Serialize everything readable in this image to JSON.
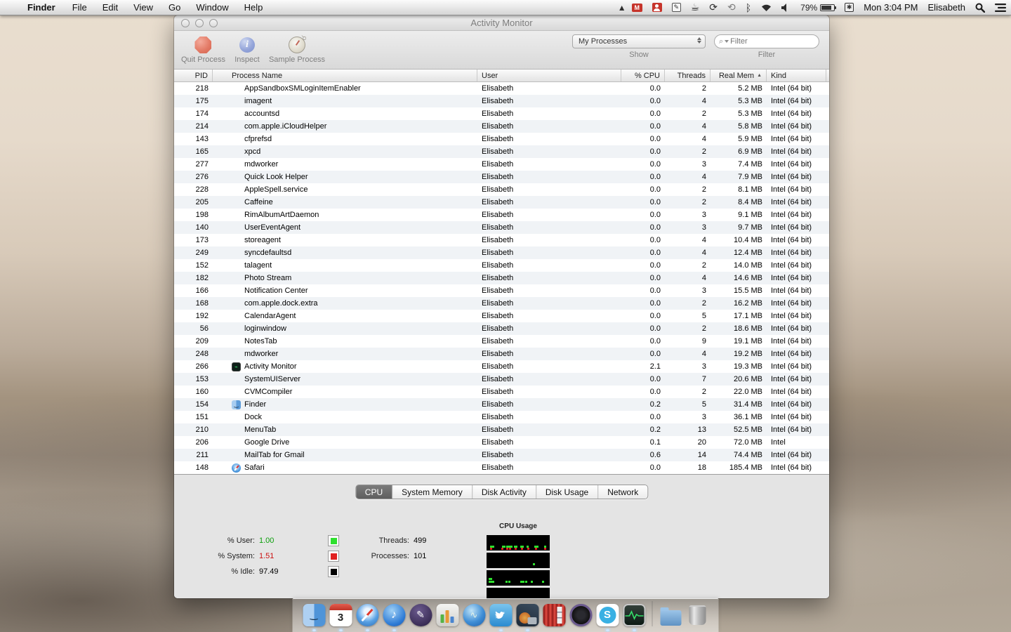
{
  "menu_bar": {
    "apple_logo": "",
    "app_name": "Finder",
    "items": [
      "File",
      "Edit",
      "View",
      "Go",
      "Window",
      "Help"
    ],
    "status": {
      "battery_percent": "79%",
      "clock": "Mon 3:04 PM",
      "user_name": "Elisabeth",
      "icons": [
        "google-drive-icon",
        "gmail-icon",
        "contacts-icon",
        "notes-icon",
        "caffeine-icon",
        "sync-icon",
        "time-machine-icon",
        "bluetooth-icon",
        "wifi-icon",
        "volume-icon",
        "battery-icon",
        "input-menu-icon",
        "spotlight-icon",
        "notification-center-icon"
      ]
    }
  },
  "window": {
    "title": "Activity Monitor",
    "toolbar": {
      "quit_label": "Quit Process",
      "inspect_label": "Inspect",
      "sample_label": "Sample Process",
      "show_value": "My Processes",
      "show_label": "Show",
      "filter_placeholder": "Filter",
      "filter_label": "Filter"
    },
    "table": {
      "columns": [
        "PID",
        "Process Name",
        "User",
        "% CPU",
        "Threads",
        "Real Mem",
        "Kind"
      ],
      "sort_column": "Real Mem",
      "sort_arrow": "▲",
      "rows": [
        {
          "pid": "218",
          "name": "AppSandboxSMLoginItemEnabler",
          "icon": "",
          "user": "Elisabeth",
          "cpu": "0.0",
          "threads": "2",
          "mem": "5.2 MB",
          "kind": "Intel (64 bit)"
        },
        {
          "pid": "175",
          "name": "imagent",
          "icon": "",
          "user": "Elisabeth",
          "cpu": "0.0",
          "threads": "4",
          "mem": "5.3 MB",
          "kind": "Intel (64 bit)"
        },
        {
          "pid": "174",
          "name": "accountsd",
          "icon": "",
          "user": "Elisabeth",
          "cpu": "0.0",
          "threads": "2",
          "mem": "5.3 MB",
          "kind": "Intel (64 bit)"
        },
        {
          "pid": "214",
          "name": "com.apple.iCloudHelper",
          "icon": "",
          "user": "Elisabeth",
          "cpu": "0.0",
          "threads": "4",
          "mem": "5.8 MB",
          "kind": "Intel (64 bit)"
        },
        {
          "pid": "143",
          "name": "cfprefsd",
          "icon": "",
          "user": "Elisabeth",
          "cpu": "0.0",
          "threads": "4",
          "mem": "5.9 MB",
          "kind": "Intel (64 bit)"
        },
        {
          "pid": "165",
          "name": "xpcd",
          "icon": "",
          "user": "Elisabeth",
          "cpu": "0.0",
          "threads": "2",
          "mem": "6.9 MB",
          "kind": "Intel (64 bit)"
        },
        {
          "pid": "277",
          "name": "mdworker",
          "icon": "",
          "user": "Elisabeth",
          "cpu": "0.0",
          "threads": "3",
          "mem": "7.4 MB",
          "kind": "Intel (64 bit)"
        },
        {
          "pid": "276",
          "name": "Quick Look Helper",
          "icon": "",
          "user": "Elisabeth",
          "cpu": "0.0",
          "threads": "4",
          "mem": "7.9 MB",
          "kind": "Intel (64 bit)"
        },
        {
          "pid": "228",
          "name": "AppleSpell.service",
          "icon": "",
          "user": "Elisabeth",
          "cpu": "0.0",
          "threads": "2",
          "mem": "8.1 MB",
          "kind": "Intel (64 bit)"
        },
        {
          "pid": "205",
          "name": "Caffeine",
          "icon": "",
          "user": "Elisabeth",
          "cpu": "0.0",
          "threads": "2",
          "mem": "8.4 MB",
          "kind": "Intel (64 bit)"
        },
        {
          "pid": "198",
          "name": "RimAlbumArtDaemon",
          "icon": "",
          "user": "Elisabeth",
          "cpu": "0.0",
          "threads": "3",
          "mem": "9.1 MB",
          "kind": "Intel (64 bit)"
        },
        {
          "pid": "140",
          "name": "UserEventAgent",
          "icon": "",
          "user": "Elisabeth",
          "cpu": "0.0",
          "threads": "3",
          "mem": "9.7 MB",
          "kind": "Intel (64 bit)"
        },
        {
          "pid": "173",
          "name": "storeagent",
          "icon": "",
          "user": "Elisabeth",
          "cpu": "0.0",
          "threads": "4",
          "mem": "10.4 MB",
          "kind": "Intel (64 bit)"
        },
        {
          "pid": "249",
          "name": "syncdefaultsd",
          "icon": "",
          "user": "Elisabeth",
          "cpu": "0.0",
          "threads": "4",
          "mem": "12.4 MB",
          "kind": "Intel (64 bit)"
        },
        {
          "pid": "152",
          "name": "talagent",
          "icon": "",
          "user": "Elisabeth",
          "cpu": "0.0",
          "threads": "2",
          "mem": "14.0 MB",
          "kind": "Intel (64 bit)"
        },
        {
          "pid": "182",
          "name": "Photo Stream",
          "icon": "",
          "user": "Elisabeth",
          "cpu": "0.0",
          "threads": "4",
          "mem": "14.6 MB",
          "kind": "Intel (64 bit)"
        },
        {
          "pid": "166",
          "name": "Notification Center",
          "icon": "",
          "user": "Elisabeth",
          "cpu": "0.0",
          "threads": "3",
          "mem": "15.5 MB",
          "kind": "Intel (64 bit)"
        },
        {
          "pid": "168",
          "name": "com.apple.dock.extra",
          "icon": "",
          "user": "Elisabeth",
          "cpu": "0.0",
          "threads": "2",
          "mem": "16.2 MB",
          "kind": "Intel (64 bit)"
        },
        {
          "pid": "192",
          "name": "CalendarAgent",
          "icon": "",
          "user": "Elisabeth",
          "cpu": "0.0",
          "threads": "5",
          "mem": "17.1 MB",
          "kind": "Intel (64 bit)"
        },
        {
          "pid": "56",
          "name": "loginwindow",
          "icon": "",
          "user": "Elisabeth",
          "cpu": "0.0",
          "threads": "2",
          "mem": "18.6 MB",
          "kind": "Intel (64 bit)"
        },
        {
          "pid": "209",
          "name": "NotesTab",
          "icon": "",
          "user": "Elisabeth",
          "cpu": "0.0",
          "threads": "9",
          "mem": "19.1 MB",
          "kind": "Intel (64 bit)"
        },
        {
          "pid": "248",
          "name": "mdworker",
          "icon": "",
          "user": "Elisabeth",
          "cpu": "0.0",
          "threads": "4",
          "mem": "19.2 MB",
          "kind": "Intel (64 bit)"
        },
        {
          "pid": "266",
          "name": "Activity Monitor",
          "icon": "activity-monitor",
          "user": "Elisabeth",
          "cpu": "2.1",
          "threads": "3",
          "mem": "19.3 MB",
          "kind": "Intel (64 bit)"
        },
        {
          "pid": "153",
          "name": "SystemUIServer",
          "icon": "",
          "user": "Elisabeth",
          "cpu": "0.0",
          "threads": "7",
          "mem": "20.6 MB",
          "kind": "Intel (64 bit)"
        },
        {
          "pid": "160",
          "name": "CVMCompiler",
          "icon": "",
          "user": "Elisabeth",
          "cpu": "0.0",
          "threads": "2",
          "mem": "22.0 MB",
          "kind": "Intel (64 bit)"
        },
        {
          "pid": "154",
          "name": "Finder",
          "icon": "finder",
          "user": "Elisabeth",
          "cpu": "0.2",
          "threads": "5",
          "mem": "31.4 MB",
          "kind": "Intel (64 bit)"
        },
        {
          "pid": "151",
          "name": "Dock",
          "icon": "",
          "user": "Elisabeth",
          "cpu": "0.0",
          "threads": "3",
          "mem": "36.1 MB",
          "kind": "Intel (64 bit)"
        },
        {
          "pid": "210",
          "name": "MenuTab",
          "icon": "",
          "user": "Elisabeth",
          "cpu": "0.2",
          "threads": "13",
          "mem": "52.5 MB",
          "kind": "Intel (64 bit)"
        },
        {
          "pid": "206",
          "name": "Google Drive",
          "icon": "",
          "user": "Elisabeth",
          "cpu": "0.1",
          "threads": "20",
          "mem": "72.0 MB",
          "kind": "Intel"
        },
        {
          "pid": "211",
          "name": "MailTab for Gmail",
          "icon": "",
          "user": "Elisabeth",
          "cpu": "0.6",
          "threads": "14",
          "mem": "74.4 MB",
          "kind": "Intel (64 bit)"
        },
        {
          "pid": "148",
          "name": "Safari",
          "icon": "safari",
          "user": "Elisabeth",
          "cpu": "0.0",
          "threads": "18",
          "mem": "185.4 MB",
          "kind": "Intel (64 bit)"
        }
      ]
    },
    "tabs": [
      "CPU",
      "System Memory",
      "Disk Activity",
      "Disk Usage",
      "Network"
    ],
    "active_tab": "CPU",
    "cpu_panel": {
      "user_label": "% User:",
      "user_value": "1.00",
      "user_color": "#0a9f0a",
      "system_label": "% System:",
      "system_value": "1.51",
      "system_color": "#cc1111",
      "idle_label": "% Idle:",
      "idle_value": "97.49",
      "idle_color": "#000000",
      "threads_label": "Threads:",
      "threads_value": "499",
      "processes_label": "Processes:",
      "processes_value": "101",
      "graph_title": "CPU Usage",
      "usage_graph": {
        "cores": [
          {
            "green": [
              6,
              9,
              24,
              27,
              31,
              34,
              38,
              43,
              46,
              53,
              56,
              63,
              76,
              79,
              91
            ],
            "green2": [],
            "red": [
              6,
              23,
              31,
              35,
              44,
              54,
              64,
              77,
              91
            ]
          },
          {
            "green": [
              73
            ],
            "green2": [],
            "red": []
          },
          {
            "green": [
              3,
              6,
              9,
              30,
              34,
              53,
              57,
              61,
              70,
              88
            ],
            "green2": [
              3,
              6
            ],
            "red": []
          },
          {
            "green": [],
            "green2": [],
            "red": []
          }
        ]
      }
    }
  },
  "dock": {
    "items": [
      {
        "name": "finder",
        "glyph": "‿",
        "running": true
      },
      {
        "name": "calendar",
        "glyph": "3",
        "running": true
      },
      {
        "name": "safari",
        "glyph": "",
        "running": true
      },
      {
        "name": "itunes",
        "glyph": "♪",
        "running": true
      },
      {
        "name": "pen-app",
        "glyph": "✎",
        "running": false
      },
      {
        "name": "charts-app",
        "glyph": "",
        "running": false
      },
      {
        "name": "google-earth",
        "glyph": "∿",
        "running": false
      },
      {
        "name": "twitter",
        "glyph": "",
        "running": true
      },
      {
        "name": "iphoto",
        "glyph": "",
        "running": true
      },
      {
        "name": "photo-booth",
        "glyph": "",
        "running": false
      },
      {
        "name": "aperture",
        "glyph": "",
        "running": false
      },
      {
        "name": "skype",
        "glyph": "S",
        "running": true
      },
      {
        "name": "activity-monitor",
        "glyph": "",
        "running": true
      },
      {
        "name": "separator",
        "glyph": "",
        "running": false
      },
      {
        "name": "documents-folder",
        "glyph": "",
        "running": false
      },
      {
        "name": "trash",
        "glyph": "",
        "running": false
      }
    ]
  }
}
